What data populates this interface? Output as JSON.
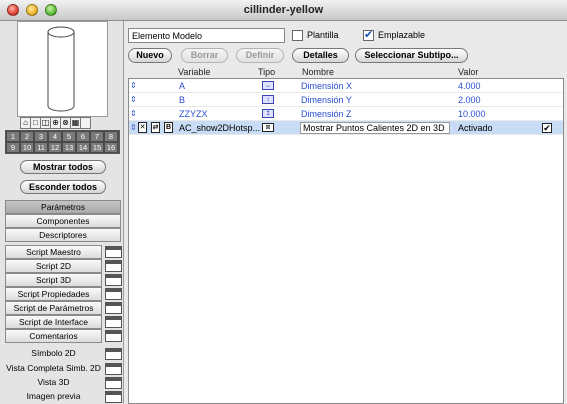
{
  "window": {
    "title": "cillinder-yellow"
  },
  "left": {
    "view_icons": [
      "⌂",
      "□",
      "◫",
      "⊕",
      "⊗",
      "▦"
    ],
    "numbers": [
      "1",
      "2",
      "3",
      "4",
      "5",
      "6",
      "7",
      "8",
      "9",
      "10",
      "11",
      "12",
      "13",
      "14",
      "15",
      "16"
    ],
    "show_all": "Mostrar todos",
    "hide_all": "Esconder todos",
    "tabs": [
      "Parámetros",
      "Componentes",
      "Descriptores"
    ],
    "scripts": [
      "Script Maestro",
      "Script 2D",
      "Script 3D",
      "Script Propiedades",
      "Script de Parámetros",
      "Script de Interface",
      "Comentarios"
    ],
    "views": [
      "Símbolo 2D",
      "Vista Completa Simb. 2D",
      "Vista 3D",
      "Imagen previa"
    ]
  },
  "top": {
    "name_value": "Elemento Modelo",
    "plantilla_label": "Plantilla",
    "plantilla_checked": false,
    "emplazable_label": "Emplazable",
    "emplazable_checked": true,
    "buttons": {
      "nuevo": "Nuevo",
      "borrar": "Borrar",
      "definir": "Definir",
      "detalles": "Detalles",
      "subtipo": "Seleccionar Subtipo..."
    }
  },
  "table": {
    "headers": {
      "variable": "Variable",
      "tipo": "Tipo",
      "nombre": "Nombre",
      "valor": "Valor"
    },
    "rows": [
      {
        "variable": "A",
        "tipo_icon": "dimension-x-icon",
        "tipo_glyph": "↔",
        "nombre": "Dimensión X",
        "valor": "4.000"
      },
      {
        "variable": "B",
        "tipo_icon": "dimension-y-icon",
        "tipo_glyph": "↕",
        "nombre": "Dimensión Y",
        "valor": "2.000"
      },
      {
        "variable": "ZZYZX",
        "tipo_icon": "dimension-z-icon",
        "tipo_glyph": "↥",
        "nombre": "Dimensión Z",
        "valor": "10.000"
      },
      {
        "variable": "AC_show2DHotsp...",
        "tipo_icon": "boolean-type-icon",
        "tipo_glyph": "⊠",
        "nombre": "Mostrar Puntos Calientes 2D en 3D",
        "valor": "Activado",
        "checked": true,
        "mini_icons": [
          "✕",
          "⇄",
          "B"
        ]
      }
    ]
  },
  "colors": {
    "accent_blue": "#2a4fcf",
    "selected_row": "#c9dcf6"
  }
}
